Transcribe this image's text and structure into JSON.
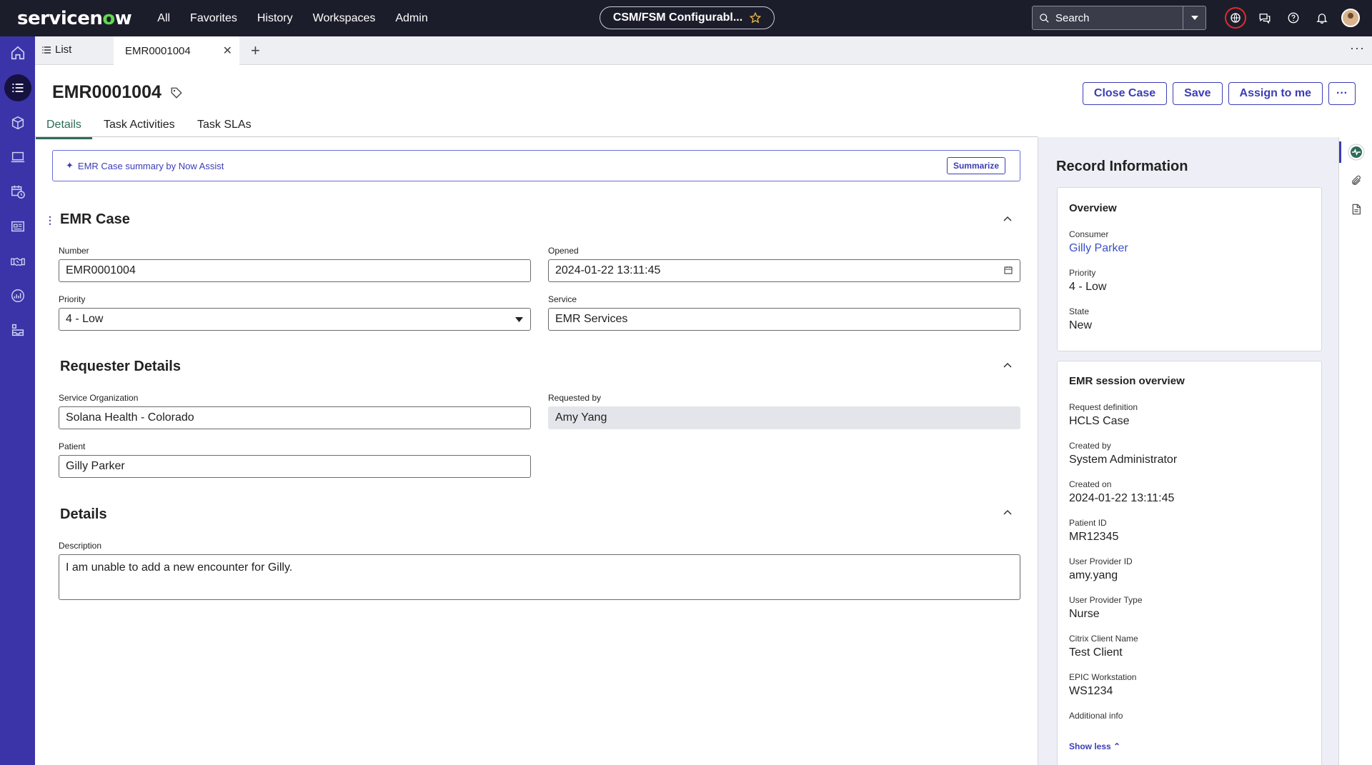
{
  "topnav": {
    "logo_pre": "servicen",
    "logo_o": "o",
    "logo_post": "w",
    "menu": [
      "All",
      "Favorites",
      "History",
      "Workspaces",
      "Admin"
    ],
    "context_pill": "CSM/FSM Configurabl...",
    "search_placeholder": "Search"
  },
  "tabs": {
    "list_label": "List",
    "active_tab": "EMR0001004"
  },
  "record": {
    "title": "EMR0001004",
    "buttons": {
      "close_case": "Close Case",
      "save": "Save",
      "assign": "Assign to me",
      "more": "···"
    },
    "subtabs": [
      "Details",
      "Task Activities",
      "Task SLAs"
    ]
  },
  "assist": {
    "label": "EMR Case summary by Now Assist",
    "button": "Summarize"
  },
  "emr_case": {
    "title": "EMR Case",
    "number_label": "Number",
    "number": "EMR0001004",
    "opened_label": "Opened",
    "opened": "2024-01-22 13:11:45",
    "priority_label": "Priority",
    "priority": "4 - Low",
    "service_label": "Service",
    "service": "EMR Services"
  },
  "requester": {
    "title": "Requester Details",
    "org_label": "Service Organization",
    "org": "Solana Health - Colorado",
    "requested_by_label": "Requested by",
    "requested_by": "Amy Yang",
    "patient_label": "Patient",
    "patient": "Gilly Parker"
  },
  "details": {
    "title": "Details",
    "description_label": "Description",
    "description": "I am unable to add a new encounter for Gilly."
  },
  "record_info": {
    "title": "Record Information",
    "overview": {
      "title": "Overview",
      "consumer_label": "Consumer",
      "consumer": "Gilly Parker",
      "priority_label": "Priority",
      "priority": "4 - Low",
      "state_label": "State",
      "state": "New"
    },
    "session": {
      "title": "EMR session overview",
      "items": [
        {
          "label": "Request definition",
          "value": "HCLS Case"
        },
        {
          "label": "Created by",
          "value": "System Administrator"
        },
        {
          "label": "Created on",
          "value": "2024-01-22 13:11:45"
        },
        {
          "label": "Patient ID",
          "value": "MR12345"
        },
        {
          "label": "User Provider ID",
          "value": "amy.yang"
        },
        {
          "label": "User Provider Type",
          "value": "Nurse"
        },
        {
          "label": "Citrix Client Name",
          "value": "Test Client"
        },
        {
          "label": "EPIC Workstation",
          "value": "WS1234"
        },
        {
          "label": "Additional info",
          "value": ""
        }
      ],
      "show_less": "Show less"
    }
  },
  "colors": {
    "nav_bg": "#1c1d2b",
    "rail_bg": "#3b34a8",
    "accent": "#3b3db5",
    "tab_green": "#2d6b58"
  }
}
